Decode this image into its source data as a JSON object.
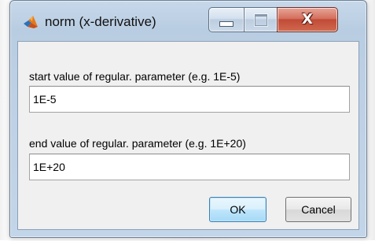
{
  "window": {
    "title": "norm (x-derivative)",
    "app_icon": "matlab-membrane-icon",
    "caption_buttons": {
      "minimize_icon": "minimize-icon",
      "maximize_icon": "maximize-icon",
      "close_glyph": "X"
    }
  },
  "form": {
    "fields": [
      {
        "label": "start value of regular. parameter (e.g. 1E-5)",
        "value": "1E-5"
      },
      {
        "label": "end value of regular. parameter (e.g. 1E+20)",
        "value": "1E+20"
      }
    ]
  },
  "buttons": {
    "ok": "OK",
    "cancel": "Cancel"
  },
  "colors": {
    "frame": "#bdd0e5",
    "close": "#c24b37",
    "default_button": "#3c7fb1",
    "client": "#f0f0f0"
  }
}
